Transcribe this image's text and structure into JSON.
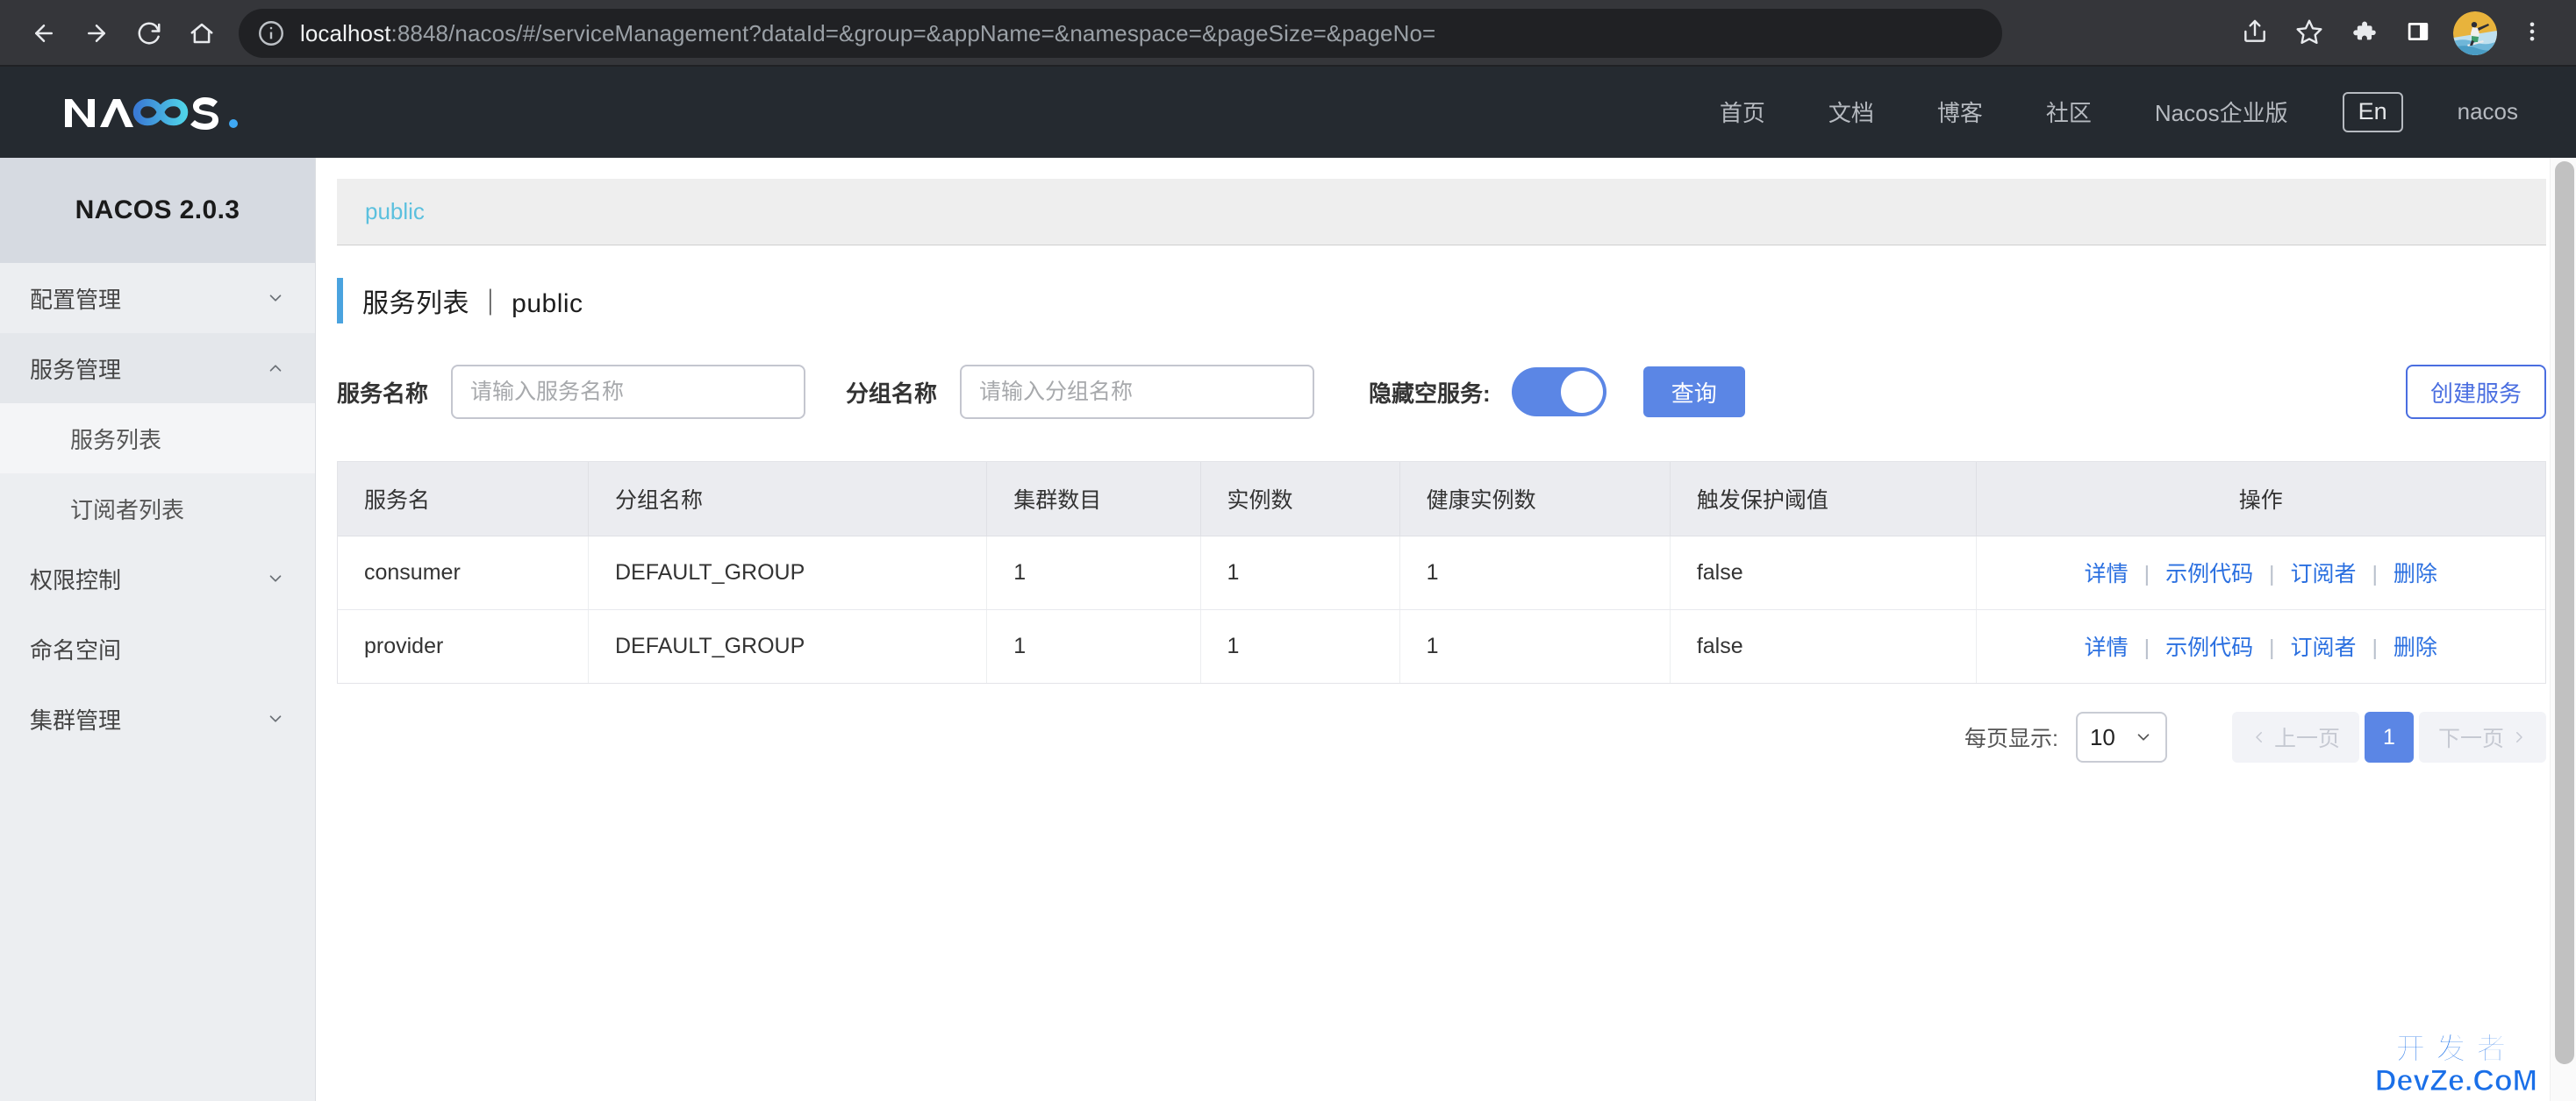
{
  "browser": {
    "back_icon": "back-arrow-icon",
    "forward_icon": "forward-arrow-icon",
    "reload_icon": "reload-icon",
    "home_icon": "home-icon",
    "info_icon": "site-info-icon",
    "url_host": "localhost",
    "url_rest": ":8848/nacos/#/serviceManagement?dataId=&group=&appName=&namespace=&pageSize=&pageNo=",
    "share_icon": "share-icon",
    "bookmark_icon": "star-icon",
    "extensions_icon": "puzzle-icon",
    "sidepanel_icon": "side-panel-icon",
    "avatar_icon": "profile-avatar",
    "menu_icon": "three-dot-menu-icon"
  },
  "header": {
    "logo_text": "NACOS.",
    "nav": [
      {
        "label": "首页"
      },
      {
        "label": "文档"
      },
      {
        "label": "博客"
      },
      {
        "label": "社区"
      },
      {
        "label": "Nacos企业版"
      }
    ],
    "language": "En",
    "user": "nacos"
  },
  "sidebar": {
    "title": "NACOS 2.0.3",
    "items": [
      {
        "label": "配置管理",
        "type": "group",
        "expanded": false,
        "chevron": "chevron-down-icon"
      },
      {
        "label": "服务管理",
        "type": "group",
        "expanded": true,
        "chevron": "chevron-up-icon"
      },
      {
        "label": "服务列表",
        "type": "sub",
        "active": true
      },
      {
        "label": "订阅者列表",
        "type": "sub",
        "active": false
      },
      {
        "label": "权限控制",
        "type": "group",
        "expanded": false,
        "chevron": "chevron-down-icon"
      },
      {
        "label": "命名空间",
        "type": "plain"
      },
      {
        "label": "集群管理",
        "type": "group",
        "expanded": false,
        "chevron": "chevron-down-icon"
      }
    ]
  },
  "main": {
    "namespace": "public",
    "page_title": "服务列表 ｜ public",
    "filters": {
      "service_name_label": "服务名称",
      "service_name_value": "",
      "service_name_placeholder": "请输入服务名称",
      "group_name_label": "分组名称",
      "group_name_value": "",
      "group_name_placeholder": "请输入分组名称",
      "hide_empty_label": "隐藏空服务:",
      "hide_empty_on": true,
      "query_button": "查询",
      "create_button": "创建服务"
    },
    "table": {
      "columns": [
        "服务名",
        "分组名称",
        "集群数目",
        "实例数",
        "健康实例数",
        "触发保护阈值",
        "操作"
      ],
      "rows": [
        {
          "service": "consumer",
          "group": "DEFAULT_GROUP",
          "clusters": "1",
          "instances": "1",
          "healthy": "1",
          "threshold": "false",
          "actions": [
            "详情",
            "示例代码",
            "订阅者",
            "删除"
          ]
        },
        {
          "service": "provider",
          "group": "DEFAULT_GROUP",
          "clusters": "1",
          "instances": "1",
          "healthy": "1",
          "threshold": "false",
          "actions": [
            "详情",
            "示例代码",
            "订阅者",
            "删除"
          ]
        }
      ]
    },
    "pagination": {
      "page_size_label": "每页显示:",
      "page_size_value": "10",
      "prev_label": "上一页",
      "next_label": "下一页",
      "current_page": "1"
    }
  },
  "watermark": {
    "cn": "开发者",
    "en": "DevZe.CoM"
  },
  "colors": {
    "accent_blue": "#5b86e5",
    "link_blue": "#2a6fe0",
    "namespace_blue": "#5bc0de",
    "header_dark": "#252a30",
    "chrome_dark": "#35363a"
  }
}
